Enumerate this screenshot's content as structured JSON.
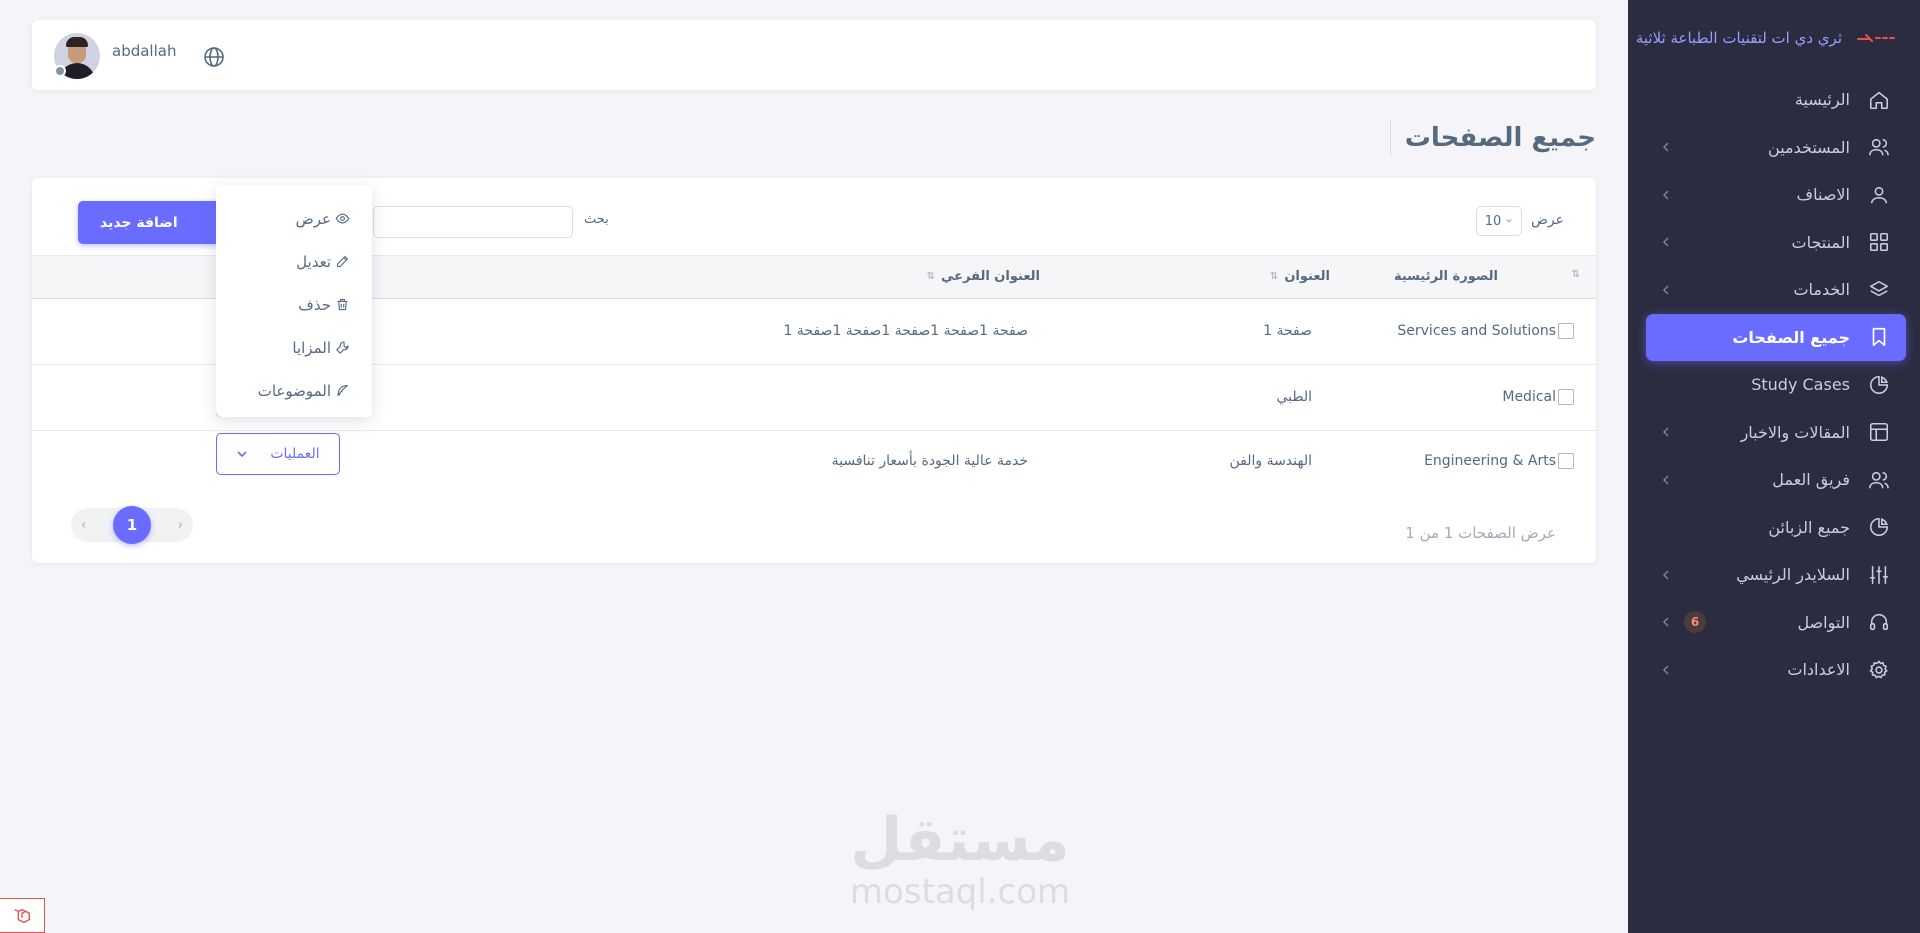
{
  "brand": {
    "title": "ثري دي ات لتقنيات الطباعة ثلاثية"
  },
  "sidebar": {
    "items": [
      {
        "label": "الرئيسية",
        "icon": "home-icon"
      },
      {
        "label": "المستخدمين",
        "icon": "users-icon"
      },
      {
        "label": "الاصناف",
        "icon": "user-icon"
      },
      {
        "label": "المنتجات",
        "icon": "grid-icon"
      },
      {
        "label": "الخدمات",
        "icon": "layers-icon"
      },
      {
        "label": "جميع الصفحات",
        "icon": "bookmark-icon"
      },
      {
        "label": "Study Cases",
        "icon": "pie-chart-icon"
      },
      {
        "label": "المقالات والاخبار",
        "icon": "layout-icon"
      },
      {
        "label": "فريق العمل",
        "icon": "team-icon"
      },
      {
        "label": "جميع الزبائن",
        "icon": "pie-chart-icon"
      },
      {
        "label": "السلايدر الرئيسي",
        "icon": "sliders-icon"
      },
      {
        "label": "التواصل",
        "icon": "headphones-icon",
        "badge": "6"
      },
      {
        "label": "الاعدادات",
        "icon": "gear-icon"
      }
    ]
  },
  "navbar": {
    "username": "abdallah"
  },
  "page": {
    "title": "جميع الصفحات"
  },
  "controls": {
    "show_label": "عرض",
    "length_value": "10",
    "search_label": "بحث",
    "add_button": "اضافة جديد"
  },
  "table": {
    "headers": {
      "image": "الصورة الرئيسية",
      "title": "العنوان",
      "subtitle": "العنوان الفرعي"
    },
    "rows": [
      {
        "image_alt": "Services and Solutions",
        "title": "صفحة 1",
        "subtitle": "صفحة 1صفحة 1صفحة 1صفحة 1صفحة 1"
      },
      {
        "image_alt": "Medical",
        "title": "الطبي",
        "subtitle": ""
      },
      {
        "image_alt": "Engineering & Arts",
        "title": "الهندسة والفن",
        "subtitle": "خدمة عالية الجودة بأسعار تنافسية"
      }
    ],
    "operations_label": "العمليات"
  },
  "pagination": {
    "prev": "‹",
    "current": "1",
    "next": "›",
    "info": "عرض الصفحات 1 من 1"
  },
  "dropdown": {
    "items": [
      {
        "label": "عرض",
        "icon": "eye-icon"
      },
      {
        "label": "تعديل",
        "icon": "edit-icon"
      },
      {
        "label": "حذف",
        "icon": "trash-icon"
      },
      {
        "label": "المزايا",
        "icon": "wrench-icon"
      },
      {
        "label": "الموضوعات",
        "icon": "feather-icon"
      }
    ]
  },
  "watermark": {
    "arabic": "مستقل",
    "english": "mostaql.com"
  },
  "colors": {
    "accent": "#696cff",
    "sidebar_bg": "#2b2c40",
    "page_bg": "#f5f5f9"
  }
}
